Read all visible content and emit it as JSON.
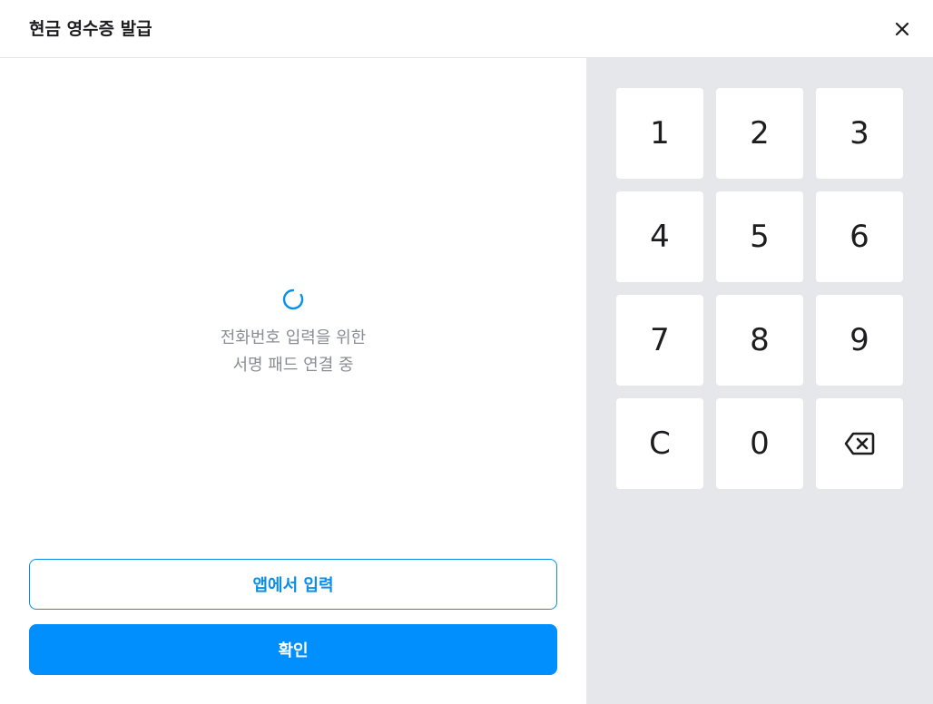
{
  "dialog": {
    "title": "현금 영수증 발급",
    "close_icon": "close-icon"
  },
  "status": {
    "spinner_icon": "loading-spinner-icon",
    "spinner_color": "#0a8fe8",
    "line1": "전화번호 입력을 위한",
    "line2": "서명 패드 연결 중"
  },
  "buttons": {
    "app_input_label": "앱에서 입력",
    "confirm_label": "확인",
    "accent_color": "#008ffd"
  },
  "keypad": {
    "keys": [
      "1",
      "2",
      "3",
      "4",
      "5",
      "6",
      "7",
      "8",
      "9",
      "C",
      "0"
    ],
    "backspace_icon": "backspace-icon"
  }
}
